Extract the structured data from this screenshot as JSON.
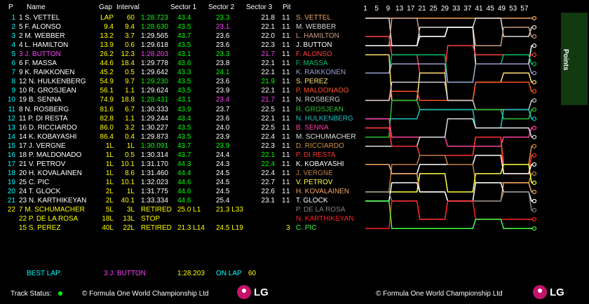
{
  "headers": {
    "p": "P",
    "name": "Name",
    "gap": "Gap",
    "interval": "Interval",
    "s1": "Sector 1",
    "s2": "Sector 2",
    "s3": "Sector 3",
    "pit": "Pit"
  },
  "timing": [
    {
      "pos": "1",
      "name": "1 S. VETTEL",
      "gap": "LAP",
      "int": "60",
      "lap": "1:28.723",
      "s1": "43.4",
      "s2": "23.3",
      "s3": "21.8",
      "pit": "1"
    },
    {
      "pos": "2",
      "name": "5 F. ALONSO",
      "gap": "9.4",
      "int": "9.4",
      "lap": "1:28.630",
      "s1": "43.5",
      "s2": "23.1",
      "s3": "22.1",
      "pit": "1"
    },
    {
      "pos": "3",
      "name": "2 M. WEBBER",
      "gap": "13.2",
      "int": "3.7",
      "lap": "1:29.565",
      "s1": "43.7",
      "s2": "23.6",
      "s3": "22.0",
      "pit": "1"
    },
    {
      "pos": "4",
      "name": "4 L. HAMILTON",
      "gap": "13.9",
      "int": "0.6",
      "lap": "1:29.618",
      "s1": "43.5",
      "s2": "23.6",
      "s3": "22.3",
      "pit": "1"
    },
    {
      "pos": "5",
      "name": "3 J. BUTTON",
      "gap": "26.2",
      "int": "12.3",
      "lap": "1:28.203",
      "s1": "43.1",
      "s2": "23.3",
      "s3": "21.7",
      "pit": "1"
    },
    {
      "pos": "6",
      "name": "6 F. MASSA",
      "gap": "44.6",
      "int": "18.4",
      "lap": "1:29.778",
      "s1": "43.6",
      "s2": "23.8",
      "s3": "22.1",
      "pit": "1"
    },
    {
      "pos": "7",
      "name": "9 K. RAIKKONEN",
      "gap": "45.2",
      "int": "0.5",
      "lap": "1:29.642",
      "s1": "43.3",
      "s2": "24.1",
      "s3": "22.1",
      "pit": "1"
    },
    {
      "pos": "8",
      "name": "12 N. HULKENBERG",
      "gap": "54.9",
      "int": "9.7",
      "lap": "1:29.230",
      "s1": "43.5",
      "s2": "23.6",
      "s3": "21.9",
      "pit": "1"
    },
    {
      "pos": "9",
      "name": "10 R. GROSJEAN",
      "gap": "56.1",
      "int": "1.1",
      "lap": "1:29.624",
      "s1": "43.5",
      "s2": "23.9",
      "s3": "22.1",
      "pit": "1"
    },
    {
      "pos": "10",
      "name": "19 B. SENNA",
      "gap": "74.9",
      "int": "18.8",
      "lap": "1:28.431",
      "s1": "43.1",
      "s2": "23.4",
      "s3": "21.7",
      "pit": "1"
    },
    {
      "pos": "11",
      "name": "8 N. ROSBERG",
      "gap": "81.6",
      "int": "6.7",
      "lap": "1:30.333",
      "s1": "43.9",
      "s2": "23.7",
      "s3": "22.5",
      "pit": "1"
    },
    {
      "pos": "12",
      "name": "11 P. DI RESTA",
      "gap": "82.8",
      "int": "1.1",
      "lap": "1:29.244",
      "s1": "43.4",
      "s2": "23.6",
      "s3": "22.1",
      "pit": "1"
    },
    {
      "pos": "13",
      "name": "16 D. RICCIARDO",
      "gap": "86.0",
      "int": "3.2",
      "lap": "1:30.227",
      "s1": "43.5",
      "s2": "24.0",
      "s3": "22.5",
      "pit": "1"
    },
    {
      "pos": "14",
      "name": "14 K. KOBAYASHI",
      "gap": "86.4",
      "int": "0.4",
      "lap": "1:29.873",
      "s1": "43.5",
      "s2": "23.9",
      "s3": "22.4",
      "pit": "1"
    },
    {
      "pos": "15",
      "name": "17 J. VERGNE",
      "gap": "1L",
      "int": "1L",
      "lap": "1:30.091",
      "s1": "43.7",
      "s2": "23.9",
      "s3": "22.3",
      "pit": "1"
    },
    {
      "pos": "16",
      "name": "18 P. MALDONADO",
      "gap": "1L",
      "int": "0.5",
      "lap": "1:30.314",
      "s1": "43.7",
      "s2": "24.4",
      "s3": "22.1",
      "pit": "1"
    },
    {
      "pos": "17",
      "name": "21 V. PETROV",
      "gap": "1L",
      "int": "10.1",
      "lap": "1:31.170",
      "s1": "44.3",
      "s2": "24.3",
      "s3": "22.4",
      "pit": "1"
    },
    {
      "pos": "18",
      "name": "20 H. KOVALAINEN",
      "gap": "1L",
      "int": "8.6",
      "lap": "1:31.460",
      "s1": "44.4",
      "s2": "24.5",
      "s3": "22.4",
      "pit": "1"
    },
    {
      "pos": "19",
      "name": "25 C. PIC",
      "gap": "1L",
      "int": "10.1",
      "lap": "1:32.023",
      "s1": "44.6",
      "s2": "24.5",
      "s3": "22.7",
      "pit": "1"
    },
    {
      "pos": "20",
      "name": "24 T. GLOCK",
      "gap": "2L",
      "int": "1L",
      "lap": "1:31.775",
      "s1": "44.6",
      "s2": "24.5",
      "s3": "22.6",
      "pit": "1"
    },
    {
      "pos": "21",
      "name": "23 N. KARTHIKEYAN",
      "gap": "2L",
      "int": "40.1",
      "lap": "1:33.334",
      "s1": "44.6",
      "s2": "25.4",
      "s3": "23.1",
      "pit": "1"
    },
    {
      "pos": "22",
      "name": "7 M. SCHUMACHER",
      "gap": "5L",
      "int": "3L",
      "lap": "RETIRED",
      "s1": "25.0 L1",
      "s2": "21.3 L33",
      "s3": "",
      "pit": ""
    },
    {
      "pos": "",
      "name": "22 P. DE LA ROSA",
      "gap": "18L",
      "int": "13L",
      "lap": "STOP",
      "s1": "",
      "s2": "",
      "s3": "",
      "pit": ""
    },
    {
      "pos": "",
      "name": "15 S. PEREZ",
      "gap": "40L",
      "int": "22L",
      "lap": "RETIRED",
      "s1": "21.3 L14",
      "s2": "24.5 L19",
      "s3": "",
      "pit": ""
    }
  ],
  "standings": [
    {
      "pit": "1",
      "name": "S. VETTEL",
      "color": "#f4a460"
    },
    {
      "pit": "1",
      "name": "M. WEBBER",
      "color": "#d9d9d9"
    },
    {
      "pit": "1",
      "name": "L. HAMILTON",
      "color": "#c89a82"
    },
    {
      "pit": "1",
      "name": "J. BUTTON",
      "color": "#ffffff"
    },
    {
      "pit": "1",
      "name": "F. ALONSO",
      "color": "#ff4040"
    },
    {
      "pit": "1",
      "name": "F. MASSA",
      "color": "#00c070"
    },
    {
      "pit": "1",
      "name": "K. RAIKKONEN",
      "color": "#9aa0d0"
    },
    {
      "pit": "1",
      "name": "S. PEREZ",
      "color": "#ffe070"
    },
    {
      "pit": "1",
      "name": "P. MALDONADO",
      "color": "#ff5020"
    },
    {
      "pit": "1",
      "name": "N. ROSBERG",
      "color": "#d0d0d0"
    },
    {
      "pit": "1",
      "name": "R. GROSJEAN",
      "color": "#30c030"
    },
    {
      "pit": "1",
      "name": "N. HULKENBERG",
      "color": "#20c0c0"
    },
    {
      "pit": "1",
      "name": "B. SENNA",
      "color": "#ff40a0"
    },
    {
      "pit": "1",
      "name": "M. SCHUMACHER",
      "color": "#e0e0e0"
    },
    {
      "pit": "1",
      "name": "D. RICCIARDO",
      "color": "#d09040"
    },
    {
      "pit": "1",
      "name": "P. DI RESTA",
      "color": "#ff3030"
    },
    {
      "pit": "1",
      "name": "K. KOBAYASHI",
      "color": "#ffffff"
    },
    {
      "pit": "1",
      "name": "J. VERGNE",
      "color": "#c08040"
    },
    {
      "pit": "1",
      "name": "V. PETROV",
      "color": "#ffff40"
    },
    {
      "pit": "1",
      "name": "H. KOVALAINEN",
      "color": "#f4a460"
    },
    {
      "pit": "1",
      "name": "T. GLOCK",
      "color": "#ffffff"
    },
    {
      "pit": "",
      "name": "P. DE LA ROSA",
      "color": "#808080"
    },
    {
      "pit": "",
      "name": "N. KARTHIKEYAN",
      "color": "#ff2020"
    },
    {
      "pit": "3",
      "name": "C. PIC",
      "color": "#40ff40"
    }
  ],
  "lap_axis": [
    "1",
    "5",
    "9",
    "13",
    "17",
    "21",
    "25",
    "29",
    "33",
    "37",
    "41",
    "45",
    "49",
    "53",
    "57"
  ],
  "points_panel_label": "Points",
  "best_lap": {
    "label": "BEST LAP:",
    "driver": "3 J. BUTTON",
    "time": "1:28.203",
    "on_lap_label": "ON LAP",
    "lap": "60"
  },
  "footer": {
    "track_status_label": "Track Status:",
    "copyright_left": "© Formula One World Championship Ltd",
    "copyright_right": "© Formula One World Championship Ltd",
    "logo_text": "LG"
  },
  "colors": {
    "yellow": "#ffff00",
    "green": "#00ff00",
    "magenta": "#ff40ff",
    "white": "#ffffff",
    "cyan": "#00ffff",
    "track_ok": "#00ff00",
    "logo": "#c5136b"
  },
  "chart_data": {
    "type": "line",
    "x_ticks": [
      "1",
      "5",
      "9",
      "13",
      "17",
      "21",
      "25",
      "29",
      "33",
      "37",
      "41",
      "45",
      "49",
      "53",
      "57"
    ],
    "series_count": 24
  }
}
